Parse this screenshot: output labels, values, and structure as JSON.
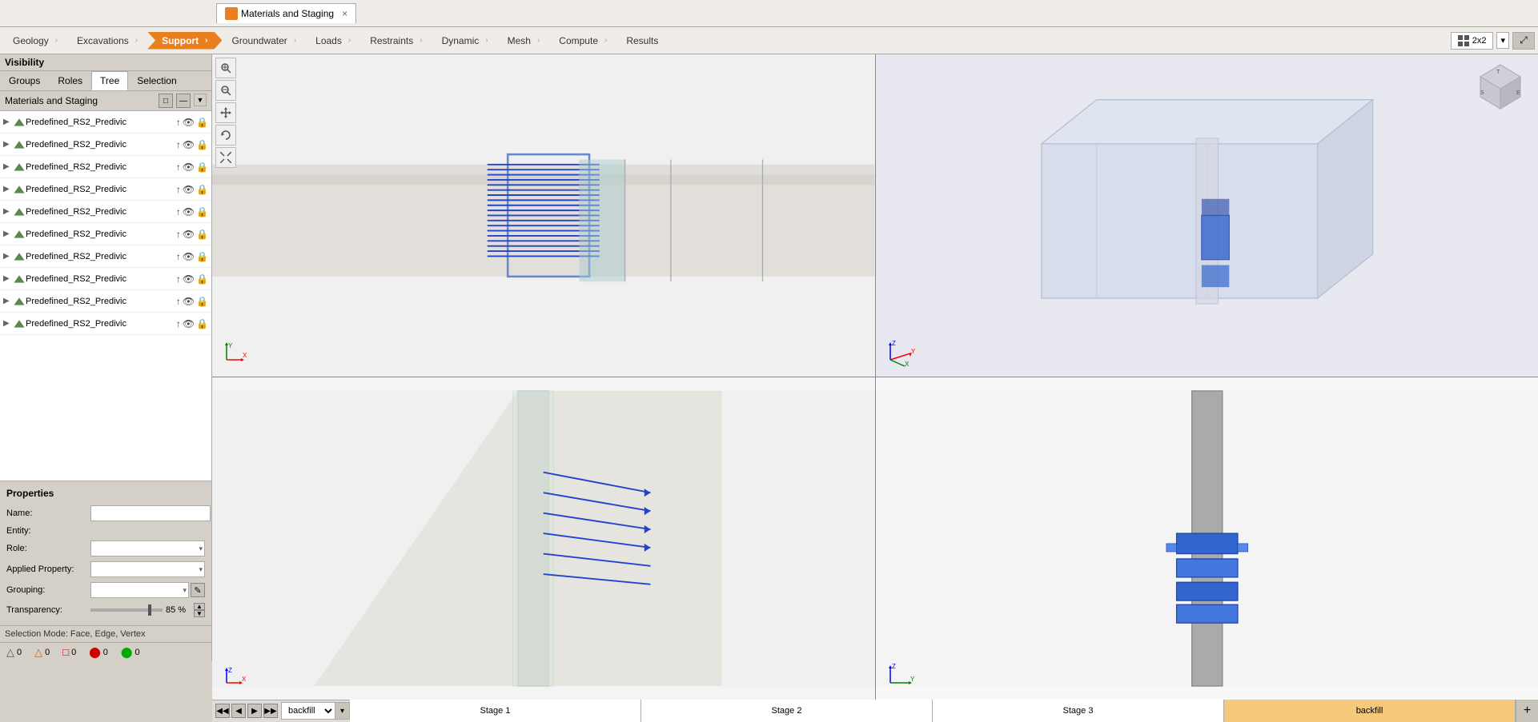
{
  "app": {
    "title": "Materials and Staging",
    "tab_close": "×"
  },
  "visibility": {
    "section_label": "Visibility",
    "tabs": [
      "Groups",
      "Roles",
      "Tree",
      "Selection"
    ],
    "active_tab": "Tree",
    "mat_header": "Materials and Staging",
    "expand_btn": "□",
    "collapse_btn": "—"
  },
  "tree_items": [
    {
      "label": "Predefined_RS2_Predivic",
      "expanded": false
    },
    {
      "label": "Predefined_RS2_Predivic",
      "expanded": false
    },
    {
      "label": "Predefined_RS2_Predivic",
      "expanded": false
    },
    {
      "label": "Predefined_RS2_Predivic",
      "expanded": false
    },
    {
      "label": "Predefined_RS2_Predivic",
      "expanded": false
    },
    {
      "label": "Predefined_RS2_Predivic",
      "expanded": false
    },
    {
      "label": "Predefined_RS2_Predivic",
      "expanded": false
    },
    {
      "label": "Predefined_RS2_Predivic",
      "expanded": false
    },
    {
      "label": "Predefined_RS2_Predivic",
      "expanded": false
    },
    {
      "label": "Predefined_RS2_Predivic",
      "expanded": false
    }
  ],
  "properties": {
    "title": "Properties",
    "name_label": "Name:",
    "entity_label": "Entity:",
    "role_label": "Role:",
    "applied_property_label": "Applied Property:",
    "grouping_label": "Grouping:",
    "transparency_label": "Transparency:",
    "transparency_value": "85 %",
    "transparency_pct": 85
  },
  "selection_mode": "Selection Mode: Face, Edge, Vertex",
  "status_bar": {
    "items": [
      {
        "icon": "triangle",
        "count": "0",
        "color": "#cc0000"
      },
      {
        "icon": "triangle-outline",
        "count": "0",
        "color": "#cc6600"
      },
      {
        "icon": "square-outline",
        "count": "0",
        "color": "#cc0000"
      },
      {
        "icon": "circle",
        "count": "0",
        "color": "#cc0000"
      },
      {
        "icon": "circle-green",
        "count": "0",
        "color": "#00aa00"
      }
    ]
  },
  "workflow": {
    "tabs": [
      "Geology",
      "Excavations",
      "Support",
      "Groundwater",
      "Loads",
      "Restraints",
      "Dynamic",
      "Mesh",
      "Compute",
      "Results"
    ],
    "active_tab": "Support"
  },
  "layout_selector": {
    "label": "2x2",
    "icon": "grid-icon"
  },
  "stages": {
    "nav_buttons": [
      "◀◀",
      "◀",
      "▶",
      "▶▶"
    ],
    "dropdown_value": "backfill",
    "tabs": [
      "Stage 1",
      "Stage 2",
      "Stage 3",
      "backfill"
    ],
    "active_stage": "backfill",
    "add_btn": "+"
  },
  "viewport_tools": {
    "zoom_in": "🔍+",
    "zoom_out": "🔍-",
    "pan": "✛",
    "rotate": "↺",
    "fit_all": "⤡"
  },
  "icons": {
    "eye": "👁",
    "lock": "🔒",
    "arrow_up": "↑",
    "edit": "✎"
  }
}
